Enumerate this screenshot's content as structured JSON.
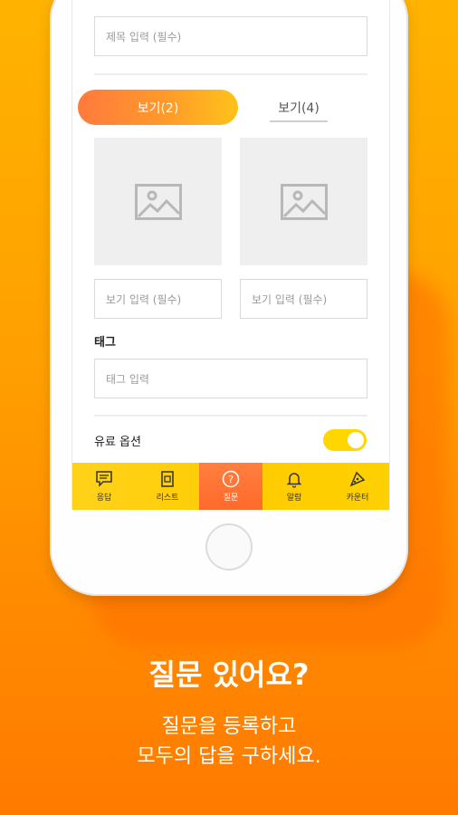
{
  "form": {
    "title_placeholder": "제목 입력 (필수)",
    "option_tab_active": "보기(2)",
    "option_tab_inactive": "보기(4)",
    "option_input_1_placeholder": "보기 입력 (필수)",
    "option_input_2_placeholder": "보기 입력 (필수)",
    "tag_label": "태그",
    "tag_placeholder": "태그 입력",
    "paid_option_label": "유료 옵션",
    "paid_option_on": true
  },
  "bottom_nav": {
    "items": [
      {
        "label": "응답",
        "icon": "chat-icon"
      },
      {
        "label": "리스트",
        "icon": "list-icon"
      },
      {
        "label": "질문",
        "icon": "question-icon",
        "active": true
      },
      {
        "label": "알람",
        "icon": "bell-icon"
      },
      {
        "label": "카운터",
        "icon": "pizza-icon"
      }
    ]
  },
  "promo": {
    "headline": "질문 있어요?",
    "line1": "질문을 등록하고",
    "line2": "모두의 답을 구하세요."
  },
  "colors": {
    "background_top": "#ffb300",
    "background_bottom": "#ff7a00",
    "nav_bar": "#ffcc00",
    "nav_active": "#ff6a2a",
    "toggle": "#ffd600"
  }
}
